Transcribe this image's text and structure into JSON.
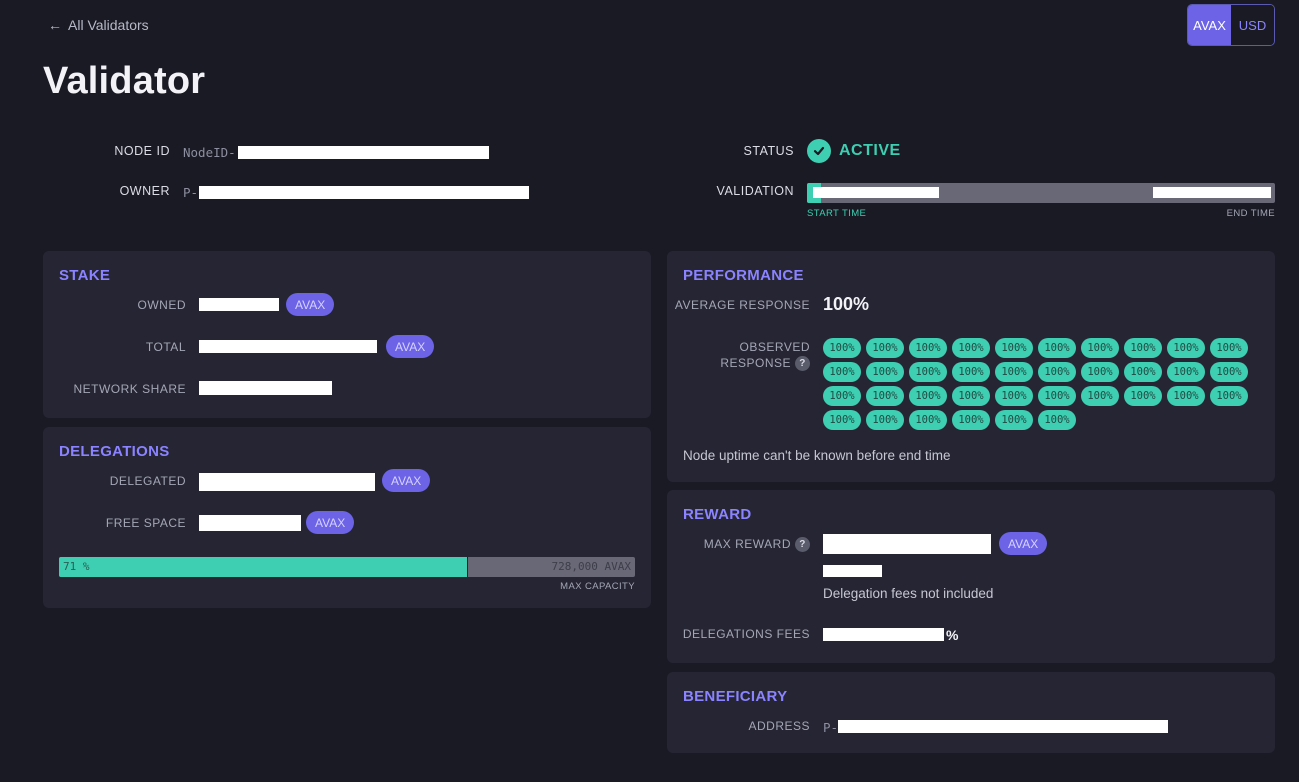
{
  "header": {
    "back_label": "All Validators",
    "title": "Validator",
    "currency_options": [
      "AVAX",
      "USD"
    ],
    "currency_selected": "AVAX"
  },
  "summary": {
    "node_id_label": "NODE ID",
    "node_id_prefix": "NodeID-",
    "owner_label": "OWNER",
    "owner_prefix": "P-",
    "status_label": "STATUS",
    "status_value": "ACTIVE",
    "validation_label": "VALIDATION",
    "validation_progress": 0.03,
    "start_time_label": "START TIME",
    "end_time_label": "END TIME"
  },
  "stake": {
    "title": "STAKE",
    "owned_label": "OWNED",
    "owned_unit": "AVAX",
    "total_label": "TOTAL",
    "total_unit": "AVAX",
    "network_share_label": "NETWORK SHARE"
  },
  "delegations": {
    "title": "DELEGATIONS",
    "delegated_label": "DELEGATED",
    "delegated_unit": "AVAX",
    "free_space_label": "FREE SPACE",
    "free_space_unit": "AVAX",
    "capacity_percent_text": "71 %",
    "capacity_fraction": 0.71,
    "capacity_value_text": "728,000 AVAX",
    "max_capacity_label": "MAX CAPACITY"
  },
  "performance": {
    "title": "PERFORMANCE",
    "average_response_label": "AVERAGE RESPONSE",
    "average_response_value": "100%",
    "observed_response_label_1": "OBSERVED",
    "observed_response_label_2": "RESPONSE",
    "observed_values": [
      "100%",
      "100%",
      "100%",
      "100%",
      "100%",
      "100%",
      "100%",
      "100%",
      "100%",
      "100%",
      "100%",
      "100%",
      "100%",
      "100%",
      "100%",
      "100%",
      "100%",
      "100%",
      "100%",
      "100%",
      "100%",
      "100%",
      "100%",
      "100%",
      "100%",
      "100%",
      "100%",
      "100%",
      "100%",
      "100%",
      "100%",
      "100%",
      "100%",
      "100%",
      "100%",
      "100%"
    ],
    "uptime_note": "Node uptime can't be known before end time"
  },
  "reward": {
    "title": "REWARD",
    "max_reward_label": "MAX REWARD",
    "max_reward_unit": "AVAX",
    "fees_note": "Delegation fees not included",
    "delegation_fees_label": "DELEGATIONS FEES",
    "delegation_fees_unit": "%"
  },
  "beneficiary": {
    "title": "BENEFICIARY",
    "address_label": "ADDRESS",
    "address_prefix": "P-"
  },
  "colors": {
    "accent": "#8b83ff",
    "pill": "#6c63e6",
    "success": "#3ecfb2",
    "background": "#191a23",
    "card": "#252533"
  }
}
